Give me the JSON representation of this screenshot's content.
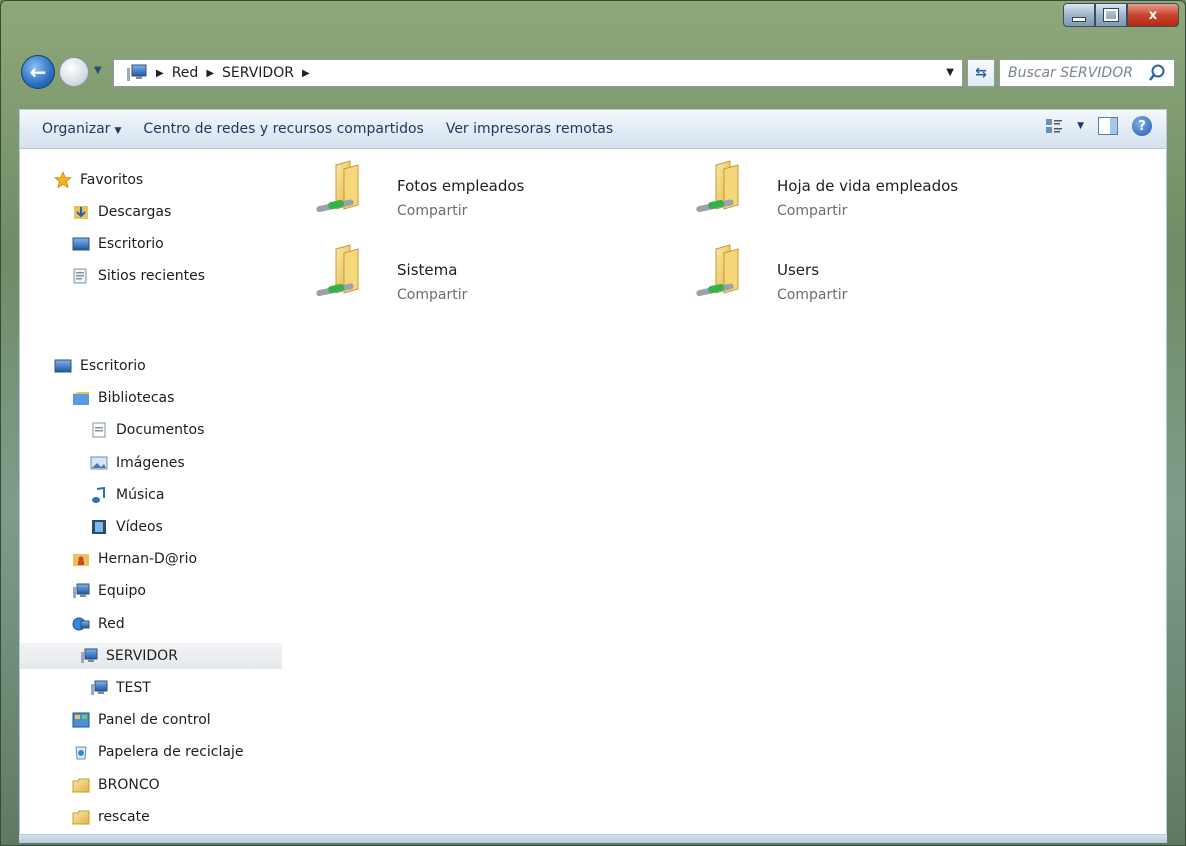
{
  "window": {
    "controls": {
      "minimize": "minimize",
      "maximize": "maximize",
      "close": "x"
    }
  },
  "address_bar": {
    "breadcrumbs": [
      "Red",
      "SERVIDOR"
    ],
    "search_placeholder": "Buscar SERVIDOR"
  },
  "toolbar": {
    "organize": "Organizar",
    "network_center": "Centro de redes y recursos compartidos",
    "remote_printers": "Ver impresoras remotas"
  },
  "nav": {
    "favorites": {
      "title": "Favoritos",
      "items": [
        {
          "label": "Descargas",
          "icon": "downloads-icon"
        },
        {
          "label": "Escritorio",
          "icon": "desktop-icon"
        },
        {
          "label": "Sitios recientes",
          "icon": "recent-places-icon"
        }
      ]
    },
    "tree": [
      {
        "label": "Escritorio",
        "icon": "desktop-icon",
        "level": 0
      },
      {
        "label": "Bibliotecas",
        "icon": "libraries-icon",
        "level": 1
      },
      {
        "label": "Documentos",
        "icon": "documents-icon",
        "level": 2
      },
      {
        "label": "Imágenes",
        "icon": "pictures-icon",
        "level": 2
      },
      {
        "label": "Música",
        "icon": "music-icon",
        "level": 2
      },
      {
        "label": "Vídeos",
        "icon": "videos-icon",
        "level": 2
      },
      {
        "label": "Hernan-D@rio",
        "icon": "user-folder-icon",
        "level": 1
      },
      {
        "label": "Equipo",
        "icon": "computer-icon",
        "level": 1
      },
      {
        "label": "Red",
        "icon": "network-icon",
        "level": 1
      },
      {
        "label": "SERVIDOR",
        "icon": "network-computer-icon",
        "level": 2,
        "selected": true
      },
      {
        "label": "TEST",
        "icon": "network-computer-icon",
        "level": 2
      },
      {
        "label": "Panel de control",
        "icon": "control-panel-icon",
        "level": 1
      },
      {
        "label": "Papelera de reciclaje",
        "icon": "recycle-bin-icon",
        "level": 1
      },
      {
        "label": "BRONCO",
        "icon": "folder-icon",
        "level": 1
      },
      {
        "label": "rescate",
        "icon": "folder-icon",
        "level": 1
      }
    ]
  },
  "shares": [
    {
      "name": "Fotos empleados",
      "type": "Compartir"
    },
    {
      "name": "Hoja de vida empleados",
      "type": "Compartir"
    },
    {
      "name": "Sistema",
      "type": "Compartir"
    },
    {
      "name": "Users",
      "type": "Compartir"
    }
  ],
  "colors": {
    "toolbar_text": "#1e395b",
    "secondary_text": "#6d6d6d",
    "selection_bg": "#e9ecef"
  }
}
